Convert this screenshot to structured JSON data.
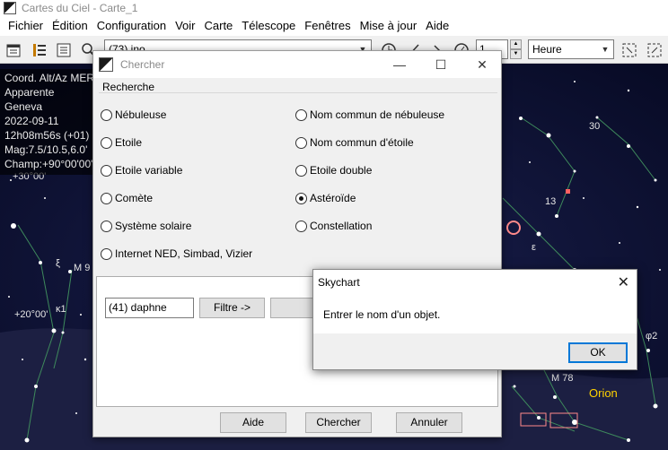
{
  "app": {
    "title": "Cartes du Ciel - Carte_1"
  },
  "menubar": [
    "Fichier",
    "Édition",
    "Configuration",
    "Voir",
    "Carte",
    "Télescope",
    "Fenêtres",
    "Mise à jour",
    "Aide"
  ],
  "toolbar": {
    "object_combo_value": "(73) ino",
    "spin_value": "1",
    "unit_combo_value": "Heure"
  },
  "info_panel": {
    "lines": [
      "Coord. Alt/Az MER",
      "Apparente",
      "Geneva",
      "2022-09-11",
      "12h08m56s (+01)",
      "Mag:7.5/10.5,6.0'",
      "Champ:+90°00'00\""
    ]
  },
  "sky_labels": {
    "alt_upper": "+30°00'",
    "alt_lower": "+20°00'",
    "m9": "M 9",
    "xi": "ξ",
    "kappa": "κ1",
    "num_30": "30",
    "num_13": "13",
    "epsilon": "ε",
    "phi2": "φ2",
    "m78": "M 78",
    "orion": "Orion"
  },
  "search_dialog": {
    "title": "Chercher",
    "group_label": "Recherche",
    "radios_left": [
      {
        "label": "Nébuleuse",
        "checked": false
      },
      {
        "label": "Etoile",
        "checked": false
      },
      {
        "label": "Etoile variable",
        "checked": false
      },
      {
        "label": "Comète",
        "checked": false
      },
      {
        "label": "Système solaire",
        "checked": false
      },
      {
        "label": "Internet NED, Simbad, Vizier",
        "checked": false
      }
    ],
    "radios_right": [
      {
        "label": "Nom commun de nébuleuse",
        "checked": false
      },
      {
        "label": "Nom commun d'étoile",
        "checked": false
      },
      {
        "label": "Etoile double",
        "checked": false
      },
      {
        "label": "Astéroïde",
        "checked": true
      },
      {
        "label": "Constellation",
        "checked": false
      }
    ],
    "name_input_value": "(41) daphne",
    "filter_button": "Filtre ->",
    "help_button": "Aide",
    "search_button": "Chercher",
    "cancel_button": "Annuler"
  },
  "message_box": {
    "title": "Skychart",
    "message": "Entrer le nom d'un objet.",
    "ok_button": "OK"
  },
  "colors": {
    "sky": "#0b1030",
    "accent": "#0078d7",
    "orion_label": "#ffd200"
  }
}
